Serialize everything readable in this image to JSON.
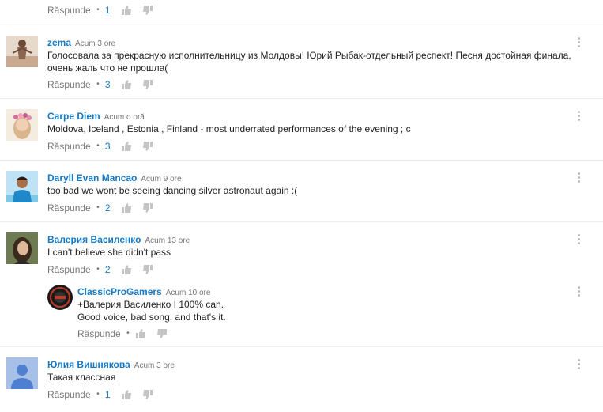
{
  "labels": {
    "reply": "Răspunde"
  },
  "top_actions": {
    "likes": "1"
  },
  "comments": [
    {
      "author": "zema",
      "time": "Acum 3 ore",
      "text": "Голосовала за прекрасную исполнительницу из Молдовы! Юрий Рыбак-отдельный респект! Песня достойная финала, очень жаль что не прошла(",
      "likes": "3"
    },
    {
      "author": "Carpe Diem",
      "time": "Acum o oră",
      "text": "Moldova, Iceland , Estonia , Finland - most underrated performances of the evening ; c",
      "likes": "3"
    },
    {
      "author": "Daryll Evan Mancao",
      "time": "Acum 9 ore",
      "text": "too bad we wont be seeing dancing silver astronaut again :(",
      "likes": "2"
    },
    {
      "author": "Валерия Василенко",
      "time": "Acum 13 ore",
      "text": "I can't believe she didn't pass",
      "likes": "2"
    },
    {
      "author": "ClassicProGamers",
      "time": "Acum 10 ore",
      "text_line1": "+Валерия Василенко I 100% can.",
      "text_line2": "Good voice, bad song, and that's it.",
      "likes": ""
    },
    {
      "author": "Юлия Вишнякова",
      "time": "Acum 3 ore",
      "text": "Такая классная",
      "likes": "1"
    }
  ],
  "icons": {
    "like": "thumbs-up-icon",
    "dislike": "thumbs-down-icon",
    "menu": "more-vert-icon"
  },
  "colors": {
    "link": "#167ac6",
    "muted": "#767676",
    "separator": "#ececec"
  }
}
